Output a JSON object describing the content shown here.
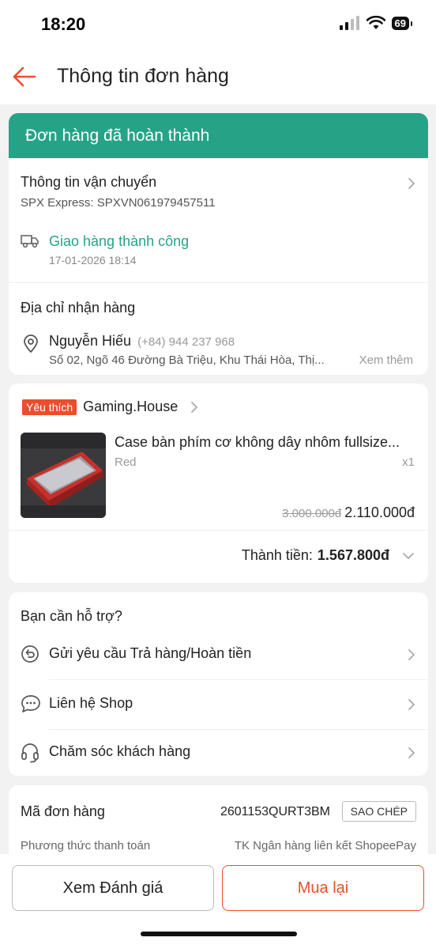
{
  "status": {
    "time": "18:20",
    "battery": "69"
  },
  "header": {
    "title": "Thông tin đơn hàng"
  },
  "order_status": {
    "banner": "Đơn hàng đã hoàn thành"
  },
  "shipping": {
    "title": "Thông tin vận chuyển",
    "carrier": "SPX Express: SPXVN061979457511",
    "delivery_status": "Giao hàng thành công",
    "delivery_time": "17-01-2026 18:14"
  },
  "address": {
    "title": "Địa chỉ nhận hàng",
    "name": "Nguyễn Hiếu",
    "phone": "(+84) 944 237 968",
    "line": "Số 02, Ngõ 46 Đường Bà Triệu, Khu Thái Hòa, Thị...",
    "more": "Xem thêm"
  },
  "shop": {
    "tag": "Yêu thích",
    "name": "Gaming.House",
    "product": {
      "name": "Case bàn phím cơ không dây nhôm fullsize...",
      "variant": "Red",
      "qty": "x1",
      "original_price": "3.000.000đ",
      "price": "2.110.000đ"
    },
    "total_label": "Thành tiền:",
    "total_value": "1.567.800đ"
  },
  "support": {
    "title": "Bạn cần hỗ trợ?",
    "items": [
      {
        "label": "Gửi yêu cầu Trả hàng/Hoàn tiền",
        "icon": "return-icon"
      },
      {
        "label": "Liên hệ Shop",
        "icon": "chat-icon"
      },
      {
        "label": "Chăm sóc khách hàng",
        "icon": "headset-icon"
      }
    ]
  },
  "order_info": {
    "id_label": "Mã đơn hàng",
    "id_value": "2601153QURT3BM",
    "copy_label": "SAO CHÉP",
    "payment_label": "Phương thức thanh toán",
    "payment_value": "TK Ngân hàng liên kết ShopeePay"
  },
  "actions": {
    "review": "Xem Đánh giá",
    "rebuy": "Mua lại"
  },
  "colors": {
    "accent": "#ee4d2d",
    "success": "#26a387"
  }
}
